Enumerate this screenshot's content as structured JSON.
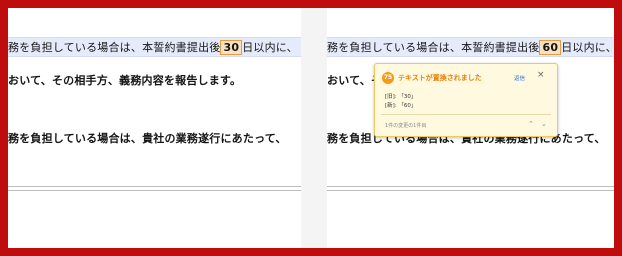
{
  "left": {
    "line1_pre": "務を負担している場合は、本誓約書提出後",
    "line1_value": "30",
    "line1_post": "日以内に、",
    "line2": "おいて、その相手方、義務内容を報告します。",
    "line3": "務を負担している場合は、貴社の業務遂行にあたって、"
  },
  "right": {
    "line1_pre": "務を負担している場合は、本誓約書提出後",
    "line1_value": "60",
    "line1_post": "日以内に、",
    "line2": "おいて、その相手方",
    "line3": "務を負担している場合は、貴社の業務遂行にあたって、"
  },
  "popup": {
    "logo": "75",
    "title": "テキストが置換されました",
    "reply": "返信",
    "close": "×",
    "old": "[旧]: 「30」",
    "new": "[新]: 「60」",
    "count": "1件の変更の1件目",
    "nav_up": "⌃",
    "nav_down": "⌄"
  },
  "colors": {
    "frame": "#bf0d0d",
    "highlight_band": "#e6ebfb",
    "change_fill": "#f7e1c1",
    "change_border": "#e49b46",
    "popup_bg": "#fff9df",
    "popup_accent": "#f39a1b"
  }
}
